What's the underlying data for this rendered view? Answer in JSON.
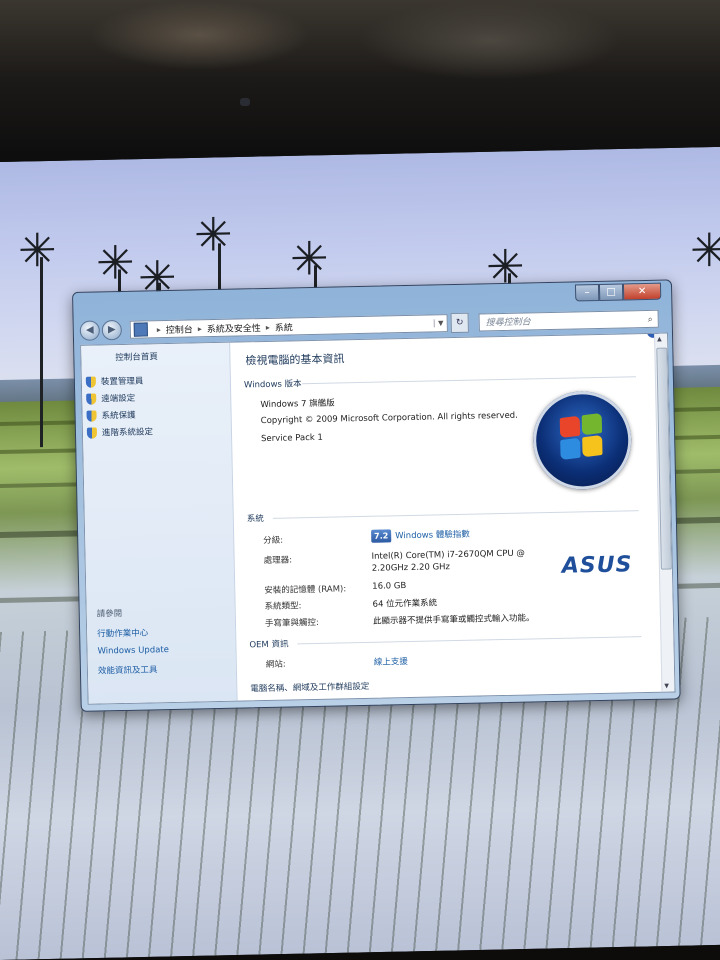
{
  "window": {
    "address": {
      "crumbs": [
        "控制台",
        "系統及安全性",
        "系統"
      ]
    },
    "search_placeholder": "搜尋控制台"
  },
  "sidebar": {
    "title": "控制台首頁",
    "links": [
      "裝置管理員",
      "遠端設定",
      "系統保護",
      "進階系統設定"
    ],
    "see_also_title": "請參閱",
    "footer_links": [
      "行動作業中心",
      "Windows Update",
      "效能資訊及工具"
    ]
  },
  "main": {
    "page_title": "檢視電腦的基本資訊",
    "edition": {
      "header": "Windows 版本",
      "name": "Windows 7 旗艦版",
      "copyright": "Copyright © 2009 Microsoft Corporation.  All rights reserved.",
      "service_pack": "Service Pack 1"
    },
    "system": {
      "header": "系統",
      "rating_label": "分級:",
      "rating_score": "7.2",
      "rating_link": "Windows 體驗指數",
      "processor_label": "處理器:",
      "processor_line1": "Intel(R) Core(TM) i7-2670QM CPU @",
      "processor_line2": "2.20GHz   2.20 GHz",
      "ram_label": "安裝的記憶體 (RAM):",
      "ram_value": "16.0 GB",
      "type_label": "系統類型:",
      "type_value": "64 位元作業系統",
      "pen_label": "手寫筆與觸控:",
      "pen_value": "此顯示器不提供手寫筆或觸控式輸入功能。",
      "oem_logo": "ASUS"
    },
    "oem": {
      "header": "OEM 資訊",
      "website_label": "網站:",
      "website_link": "線上支援"
    },
    "computer_name_header": "電腦名稱、網域及工作群組設定"
  },
  "colors": {
    "accent": "#1e5fa5",
    "title": "#1e395b",
    "flag_red": "#e8452b",
    "flag_green": "#74b72e",
    "flag_blue": "#2e8ce0",
    "flag_yellow": "#f6c21c"
  }
}
